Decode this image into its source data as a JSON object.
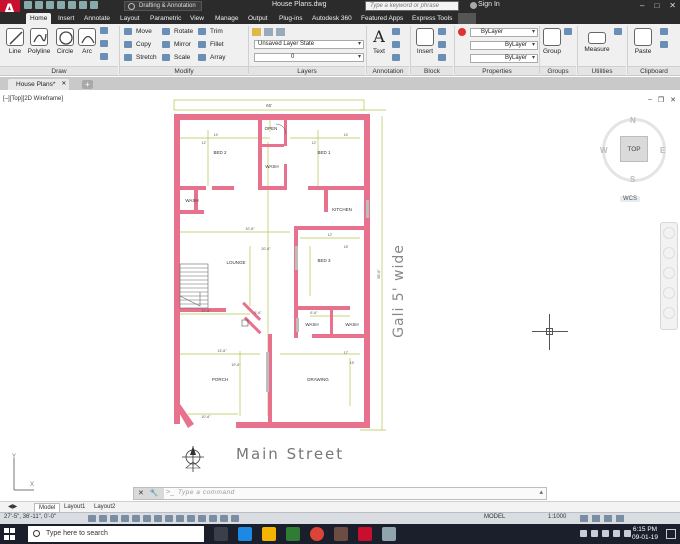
{
  "app": {
    "document_title": "House Plans.dwg",
    "workspace": "Drafting & Annotation",
    "search_placeholder": "Type a keyword or phrase",
    "signin": "Sign In"
  },
  "ribbon_tabs": [
    "Home",
    "Insert",
    "Annotate",
    "Layout",
    "Parametric",
    "View",
    "Manage",
    "Output",
    "Plug-ins",
    "Autodesk 360",
    "Featured Apps",
    "Express Tools"
  ],
  "ribbon": {
    "draw": {
      "title": "Draw",
      "line": "Line",
      "polyline": "Polyline",
      "circle": "Circle",
      "arc": "Arc"
    },
    "modify": {
      "title": "Modify",
      "move": "Move",
      "copy": "Copy",
      "stretch": "Stretch",
      "rotate": "Rotate",
      "mirror": "Mirror",
      "scale": "Scale",
      "trim": "Trim",
      "fillet": "Fillet",
      "array": "Array"
    },
    "layers": {
      "title": "Layers",
      "layer_state": "Unsaved Layer State",
      "current_layer": "0"
    },
    "annotation": {
      "title": "Annotation",
      "text": "Text"
    },
    "block": {
      "title": "Block",
      "insert": "Insert"
    },
    "properties": {
      "title": "Properties",
      "color": "ByLayer",
      "linetype": "ByLayer",
      "lineweight": "ByLayer"
    },
    "groups": {
      "title": "Groups",
      "group": "Group"
    },
    "utilities": {
      "title": "Utilities",
      "measure": "Measure"
    },
    "clipboard": {
      "title": "Clipboard",
      "paste": "Paste"
    }
  },
  "file_tab": "House Plans*",
  "viewport_label": "[–][Top][2D Wireframe]",
  "viewcube": {
    "top": "TOP",
    "north": "N",
    "south": "S",
    "east": "E",
    "west": "W",
    "wcs": "WCS"
  },
  "plan": {
    "overall_width": "65'",
    "rooms": {
      "open": "OPEN",
      "bed2": "BED 2",
      "wash1": "WASH",
      "bed1": "BED 1",
      "wash2": "WASH",
      "kitchen": "KITCHEN",
      "lounge": "LOUNGE",
      "bed3": "BED 3",
      "wash3": "WASH",
      "wash4": "WASH",
      "porch": "PORCH",
      "drawing": "DRAWING"
    },
    "dims": {
      "d1": "14'",
      "d2": "14'",
      "d3": "12'",
      "d4": "12'",
      "d5": "10'-6\"",
      "d6": "20'-6\"",
      "d7": "12'",
      "d8": "18'",
      "d9": "12'-6\"",
      "d10": "5'-6\"",
      "d11": "6'-6\"",
      "d12": "13'-6\"",
      "d13": "17'",
      "d14": "19'-6\"",
      "d15": "15'",
      "d16": "10'-6\"",
      "d17": "55'-6\""
    }
  },
  "street_label": "Main Street",
  "gali_label": "Gali 5' wide",
  "command_placeholder": "Type a command",
  "layout_tabs": [
    "Model",
    "Layout1",
    "Layout2"
  ],
  "status": {
    "coords": "27'-5\", 36'-11\", 0'-0\"",
    "model": "MODEL",
    "scale": "1:1000"
  },
  "taskbar": {
    "search": "Type here to search",
    "time": "6:15 PM",
    "date": "09-01-19"
  },
  "colors": {
    "wall": "#e8718e",
    "dim": "#b9c24f",
    "accent_red": "#c8102e"
  }
}
